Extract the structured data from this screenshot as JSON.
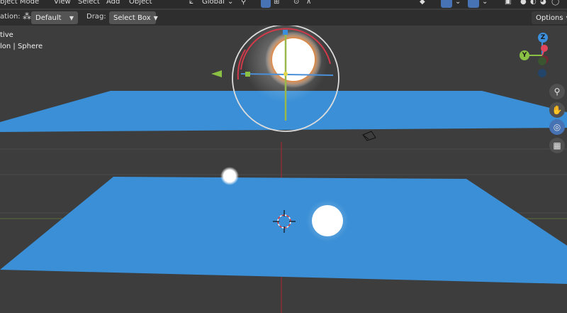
{
  "header": {
    "mode_label": "bject Mode",
    "menus": [
      "View",
      "Select",
      "Add",
      "Object"
    ],
    "orientation_label": "Global"
  },
  "tool_settings": {
    "orientation_prefix": "ation:",
    "pivot_value": "Default",
    "drag_label": "Drag:",
    "drag_value": "Select Box",
    "options_label": "Options"
  },
  "viewport_overlay": {
    "line1": "tive",
    "line2": "lon | Sphere"
  },
  "axis_gizmo": {
    "z": "Z",
    "y": "Y",
    "x_color": "#e0455b",
    "y_color": "#8ac043",
    "z_color": "#3c8fdc"
  },
  "colors": {
    "plane": "#3a8fd6",
    "background": "#3d3d3d",
    "accent": "#4772b3"
  },
  "nav_icons": [
    "zoom-icon",
    "hand-pan-icon",
    "camera-view-icon",
    "grid-ortho-icon"
  ]
}
